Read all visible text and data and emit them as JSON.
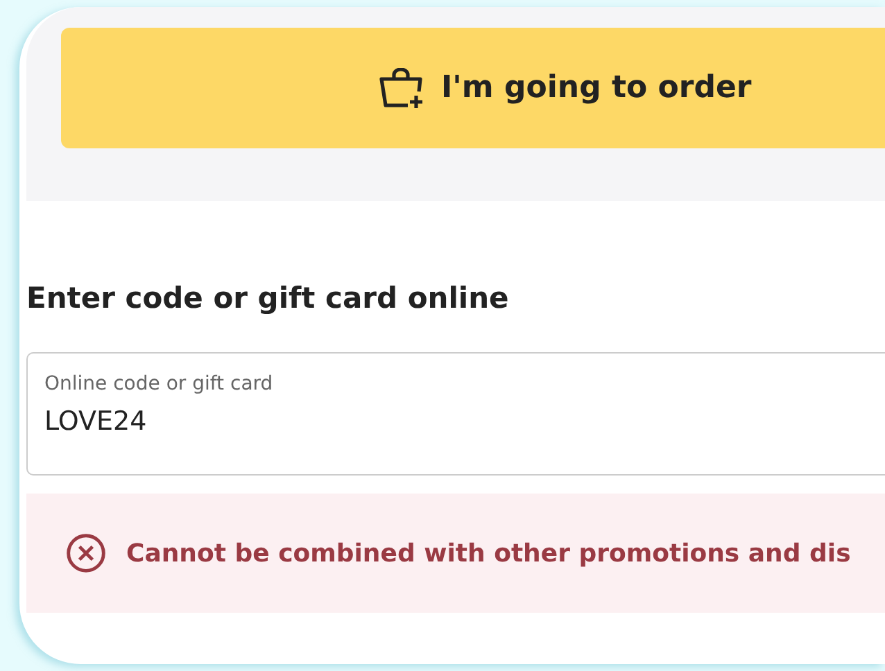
{
  "order_button": {
    "label": "I'm going to order"
  },
  "code_section": {
    "heading": "Enter code or gift card online",
    "field": {
      "label": "Online code or gift card",
      "value": "LOVE24"
    },
    "message": {
      "kind": "error",
      "text": "Cannot be combined with other promotions and dis"
    }
  }
}
